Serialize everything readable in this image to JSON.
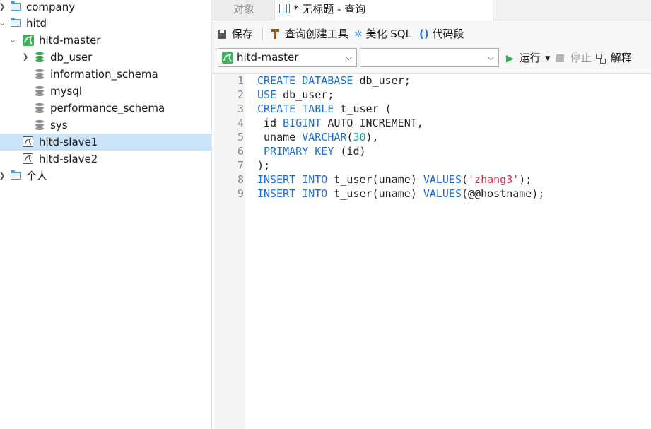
{
  "sidebar": {
    "items": [
      {
        "label": "company"
      },
      {
        "label": "hitd"
      },
      {
        "label": "hitd-master"
      },
      {
        "label": "db_user"
      },
      {
        "label": "information_schema"
      },
      {
        "label": "mysql"
      },
      {
        "label": "performance_schema"
      },
      {
        "label": "sys"
      },
      {
        "label": "hitd-slave1"
      },
      {
        "label": "hitd-slave2"
      },
      {
        "label": "个人"
      }
    ]
  },
  "tabs": {
    "objects": "对象",
    "query": "* 无标题 - 查询"
  },
  "toolbar": {
    "save": "保存",
    "query_builder": "查询创建工具",
    "beautify": "美化 SQL",
    "snippet": "代码段"
  },
  "selectbar": {
    "connection": "hitd-master",
    "database": "",
    "run": "运行",
    "stop": "停止",
    "explain": "解释"
  },
  "editor": {
    "line_numbers": [
      "1",
      "2",
      "3",
      "4",
      "5",
      "6",
      "7",
      "8",
      "9"
    ],
    "lines": [
      "CREATE DATABASE db_user;",
      "USE db_user;",
      "CREATE TABLE t_user (",
      " id BIGINT AUTO_INCREMENT,",
      " uname VARCHAR(30),",
      " PRIMARY KEY (id)",
      ");",
      "INSERT INTO t_user(uname) VALUES('zhang3');",
      "INSERT INTO t_user(uname) VALUES(@@hostname);"
    ]
  },
  "colors": {
    "keyword": "#1a6fd2",
    "number": "#13a48b",
    "string": "#d6284c",
    "selection": "#cce4f7",
    "connection_active": "#3cb55a"
  }
}
